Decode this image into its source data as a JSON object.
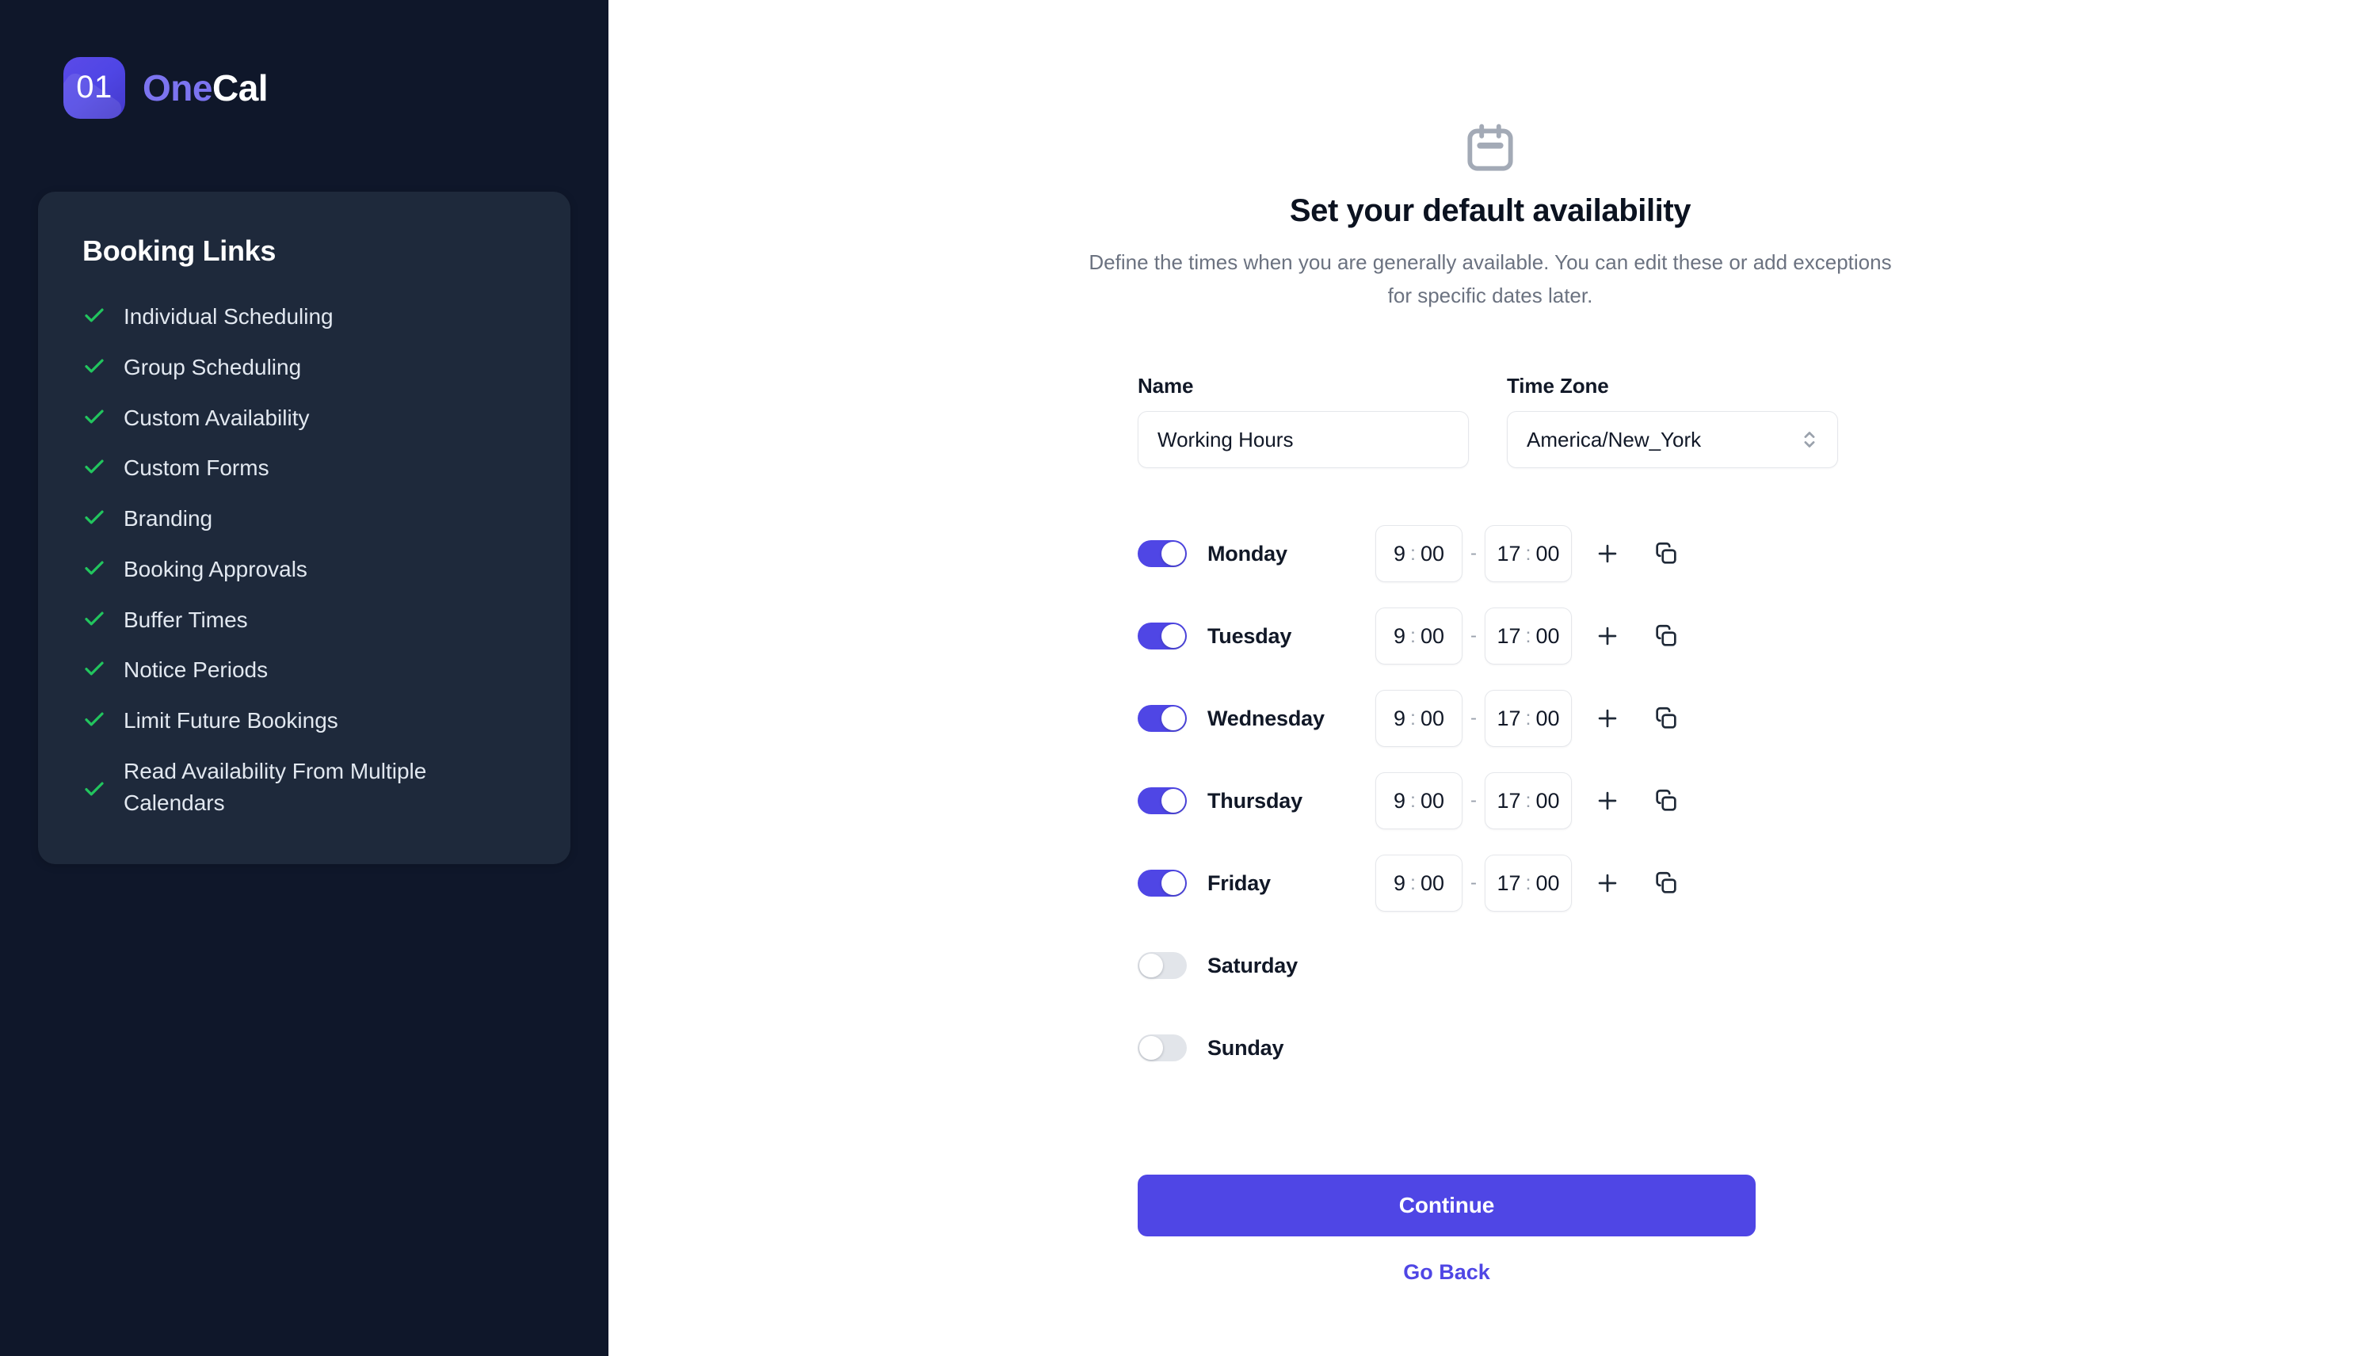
{
  "brand": {
    "mark_text": "01",
    "name_first": "One",
    "name_second": "Cal"
  },
  "sidebar": {
    "card_title": "Booking Links",
    "features": [
      {
        "label": "Individual Scheduling"
      },
      {
        "label": "Group Scheduling"
      },
      {
        "label": "Custom Availability"
      },
      {
        "label": "Custom Forms"
      },
      {
        "label": "Branding"
      },
      {
        "label": "Booking Approvals"
      },
      {
        "label": "Buffer Times"
      },
      {
        "label": "Notice Periods"
      },
      {
        "label": "Limit Future Bookings"
      },
      {
        "label": "Read Availability From Multiple Calendars"
      }
    ]
  },
  "main": {
    "title": "Set your default availability",
    "subtitle": "Define the times when you are generally available. You can edit these or add exceptions for specific dates later.",
    "name_label": "Name",
    "name_value": "Working Hours",
    "name_placeholder": "Working Hours",
    "timezone_label": "Time Zone",
    "timezone_value": "America/New_York",
    "range_separator": "-",
    "time_separator": ":",
    "continue_label": "Continue",
    "go_back_label": "Go Back"
  },
  "schedule": {
    "days": [
      {
        "name": "Monday",
        "enabled": true,
        "start_hour": "9",
        "start_minute": "00",
        "end_hour": "17",
        "end_minute": "00"
      },
      {
        "name": "Tuesday",
        "enabled": true,
        "start_hour": "9",
        "start_minute": "00",
        "end_hour": "17",
        "end_minute": "00"
      },
      {
        "name": "Wednesday",
        "enabled": true,
        "start_hour": "9",
        "start_minute": "00",
        "end_hour": "17",
        "end_minute": "00"
      },
      {
        "name": "Thursday",
        "enabled": true,
        "start_hour": "9",
        "start_minute": "00",
        "end_hour": "17",
        "end_minute": "00"
      },
      {
        "name": "Friday",
        "enabled": true,
        "start_hour": "9",
        "start_minute": "00",
        "end_hour": "17",
        "end_minute": "00"
      },
      {
        "name": "Saturday",
        "enabled": false
      },
      {
        "name": "Sunday",
        "enabled": false
      }
    ]
  },
  "colors": {
    "accent": "#4F46E5",
    "sidebar_bg": "#0F172A",
    "card_bg": "#1E293B",
    "check_green": "#22C55E",
    "muted_text": "#6B7280",
    "toggle_off": "#E2E5EA"
  },
  "icons": {
    "calendar": "calendar-icon",
    "check": "check-icon",
    "add": "plus-icon",
    "duplicate": "copy-icon",
    "select_arrows": "chevron-up-down-icon"
  }
}
